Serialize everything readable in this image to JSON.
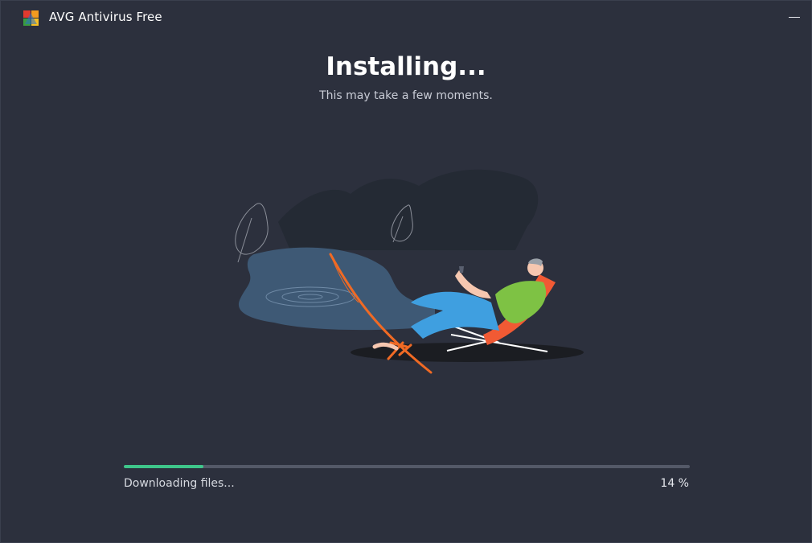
{
  "window": {
    "title": "AVG Antivirus Free",
    "logo_icon": "avg-logo-icon",
    "minimize_icon": "minimize-icon"
  },
  "main": {
    "heading": "Installing...",
    "subheading": "This may take a few moments."
  },
  "progress": {
    "status": "Downloading files...",
    "percent_label": "14 %",
    "fraction": 0.14,
    "fill_color": "#3ec68a",
    "track_color": "#545968"
  },
  "theme": {
    "background": "#2c303d",
    "text": "#ffffff",
    "muted_text": "#c9ccd6"
  }
}
